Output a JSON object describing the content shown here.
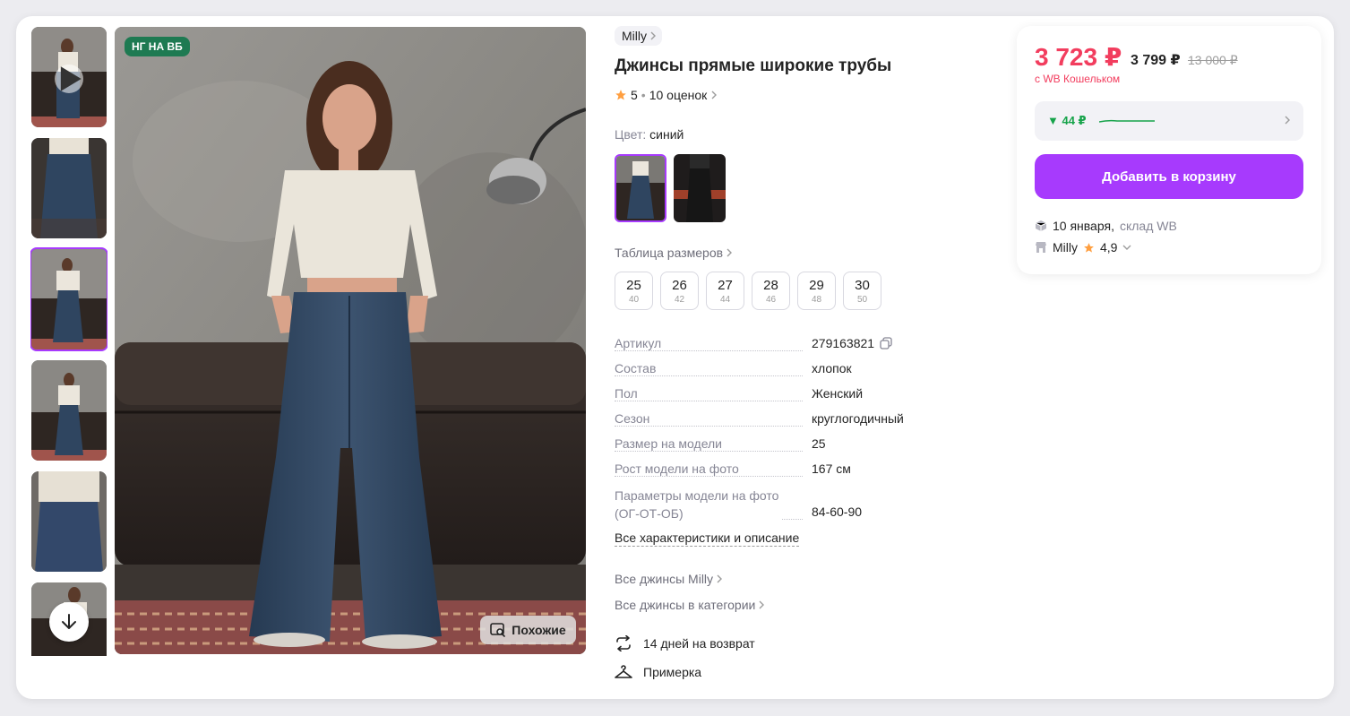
{
  "promo_badge": "НГ НА ВБ",
  "similar_label": "Похожие",
  "brand": "Milly",
  "title": "Джинсы прямые широкие трубы",
  "rating": {
    "value": "5",
    "reviews": "10 оценок"
  },
  "color": {
    "label": "Цвет:",
    "value": "синий"
  },
  "size_table_link": "Таблица размеров",
  "sizes": [
    {
      "ru": "25",
      "eu": "40"
    },
    {
      "ru": "26",
      "eu": "42"
    },
    {
      "ru": "27",
      "eu": "44"
    },
    {
      "ru": "28",
      "eu": "46"
    },
    {
      "ru": "29",
      "eu": "48"
    },
    {
      "ru": "30",
      "eu": "50"
    }
  ],
  "specs": [
    {
      "key": "Артикул",
      "value": "279163821"
    },
    {
      "key": "Состав",
      "value": "хлопок"
    },
    {
      "key": "Пол",
      "value": "Женский"
    },
    {
      "key": "Сезон",
      "value": "круглогодичный"
    },
    {
      "key": "Размер на модели",
      "value": "25"
    },
    {
      "key": "Рост модели на фото",
      "value": "167 см"
    },
    {
      "key_line1": "Параметры модели на фото",
      "key_line2": "(ОГ-ОТ-ОБ)",
      "value": "84-60-90"
    }
  ],
  "all_specs_link": "Все характеристики и описание",
  "links": {
    "brand_category": "Все джинсы Milly",
    "category": "Все джинсы в категории"
  },
  "features": {
    "return": "14 дней на возврат",
    "fitting": "Примерка"
  },
  "price": {
    "current": "3 723 ₽",
    "regular": "3 799 ₽",
    "old": "13 000 ₽",
    "wallet_note": "с WB Кошельком",
    "drop": "▼ 44 ₽"
  },
  "add_to_cart": "Добавить в корзину",
  "delivery": {
    "date": "10 января",
    "separator": ",",
    "warehouse": "склад WB"
  },
  "seller": {
    "name": "Milly",
    "rating": "4,9"
  },
  "colors": {
    "accent": "#a73afd",
    "price": "#f23d5e",
    "drop": "#16a34a",
    "badge": "#1e7a52",
    "star": "#ff9f40"
  }
}
